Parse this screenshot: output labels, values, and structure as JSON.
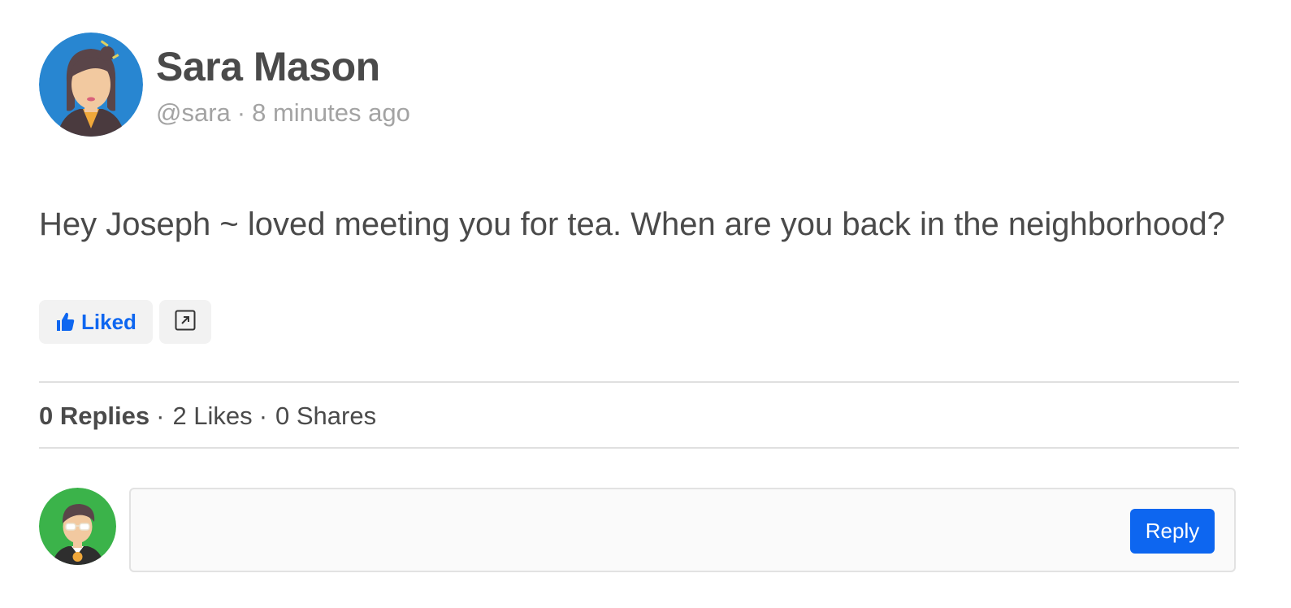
{
  "post": {
    "author_name": "Sara Mason",
    "handle": "@sara",
    "separator": "·",
    "time_ago": "8 minutes ago",
    "body": "Hey Joseph ~ loved meeting you for tea. When are you back in the neighborhood?",
    "author_avatar_bg": "#2886d1"
  },
  "actions": {
    "like_label": "Liked",
    "like_icon": "thumbs-up-icon",
    "share_icon": "external-link-icon",
    "accent_color": "#0d66f0"
  },
  "stats": {
    "replies": "0 Replies",
    "likes": "2 Likes",
    "shares": "0 Shares",
    "separator": "·"
  },
  "reply": {
    "input_value": "",
    "button_label": "Reply",
    "user_avatar_bg": "#3bb34a"
  }
}
